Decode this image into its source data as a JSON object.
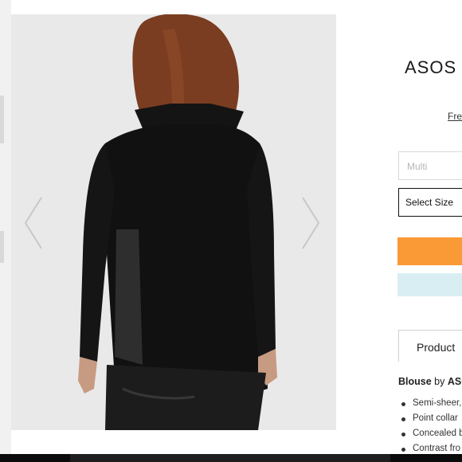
{
  "product": {
    "title": "ASOS C",
    "delivery_link": "Free",
    "colour_placeholder": "Multi",
    "size_select_label": "Select Size",
    "tabs": [
      {
        "label": "Product"
      }
    ],
    "description": {
      "name": "Blouse",
      "by": " by ",
      "brand": "ASOS"
    },
    "features": [
      "Semi-sheer,",
      "Point collar",
      "Concealed b",
      "Contrast fro"
    ]
  },
  "gallery": {
    "prev_icon": "chevron-left-icon",
    "next_icon": "chevron-right-icon"
  },
  "colors": {
    "add_to_bag": "#fa9a37",
    "save": "#d9eef2",
    "gallery_bg": "#e9e9e9"
  }
}
